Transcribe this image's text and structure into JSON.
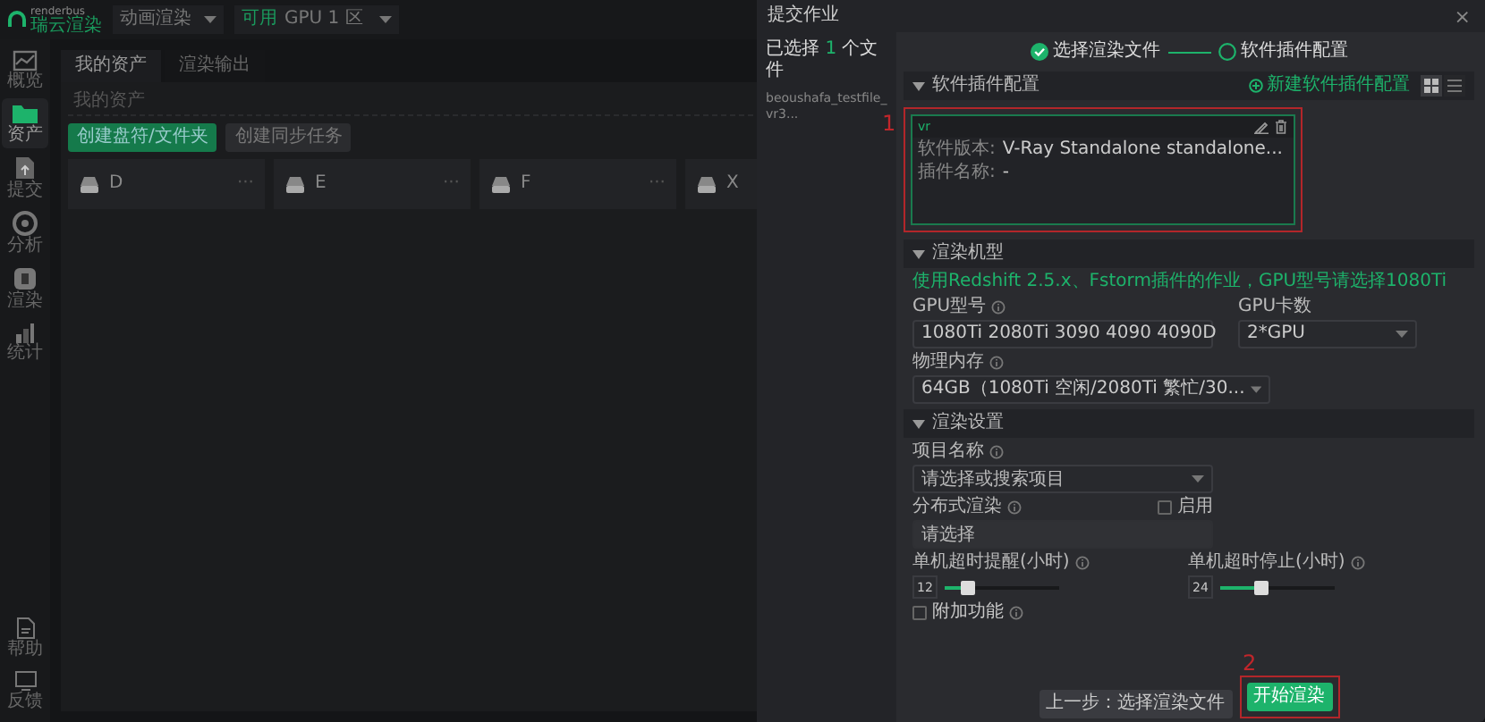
{
  "app": {
    "logo": {
      "brand": "renderbus",
      "name": "瑞云渲染"
    },
    "render_type": "动画渲染",
    "zone": {
      "badge": "可用",
      "name": "GPU 1 区"
    }
  },
  "sidebar": [
    {
      "label": "概览",
      "selected": false
    },
    {
      "label": "资产",
      "selected": true
    },
    {
      "label": "提交",
      "selected": false
    },
    {
      "label": "分析",
      "selected": false
    },
    {
      "label": "渲染",
      "selected": false
    },
    {
      "label": "统计",
      "selected": false
    },
    {
      "label": "帮助",
      "selected": false
    },
    {
      "label": "反馈",
      "selected": false
    }
  ],
  "tabs": [
    {
      "label": "我的资产",
      "selected": true
    },
    {
      "label": "渲染输出",
      "selected": false
    }
  ],
  "breadcrumb": "我的资产",
  "actions": [
    {
      "label": "创建盘符/文件夹",
      "kind": "primary"
    },
    {
      "label": "创建同步任务",
      "kind": "secondary"
    }
  ],
  "drives": [
    {
      "name": "D",
      "more": "···"
    },
    {
      "name": "E",
      "more": "···"
    },
    {
      "name": "F",
      "more": "···"
    },
    {
      "name": "X"
    }
  ],
  "dialog": {
    "title": "提交作业",
    "close": "×",
    "selected_count": {
      "prefix": "已选择",
      "count": "1",
      "suffix": "个文件"
    },
    "files": [
      "beoushafa_testfile_vr3..."
    ],
    "steps": [
      {
        "label": "选择渲染文件",
        "done": true
      },
      {
        "label": "软件插件配置",
        "done": false
      }
    ],
    "software_section": {
      "title": "软件插件配置",
      "expanded": true,
      "new_config": "新建软件插件配置",
      "views": [
        {
          "kind": "grid",
          "selected": true
        },
        {
          "kind": "list",
          "selected": false
        }
      ],
      "configs": [
        {
          "name": "vr",
          "version_label": "软件版本:",
          "version": "V-Ray Standalone standalone...",
          "plugin_label": "插件名称:",
          "plugin": "-",
          "callout": "1"
        }
      ]
    },
    "machine_section": {
      "title": "渲染机型",
      "expanded": true,
      "note": "使用Redshift 2.5.x、Fstorm插件的作业，GPU型号请选择1080Ti",
      "fields": [
        {
          "label": "GPU型号",
          "info": true,
          "kind": "select",
          "value": "1080Ti 2080Ti 3090 4090 4090D"
        },
        {
          "label": "GPU卡数",
          "info": false,
          "kind": "select",
          "value": "2*GPU"
        },
        {
          "label": "物理内存",
          "info": true,
          "kind": "select",
          "value": "64GB（1080Ti 空闲/2080Ti 繁忙/30..."
        }
      ]
    },
    "render_section": {
      "title": "渲染设置",
      "expanded": true,
      "project": {
        "label": "项目名称",
        "info": true,
        "kind": "select",
        "placeholder": "请选择或搜索项目"
      },
      "distributed": {
        "label": "分布式渲染",
        "info": true,
        "enable_label": "启用",
        "checked": false,
        "placeholder": "请选择"
      },
      "sliders": [
        {
          "label": "单机超时提醒(小时)",
          "value": "12",
          "level": 0.2
        },
        {
          "label": "单机超时停止(小时)",
          "value": "24",
          "level": 0.36
        }
      ],
      "extra": {
        "label": "附加功能",
        "checked": false
      }
    },
    "footer": [
      {
        "label": "上一步：选择渲染文件",
        "kind": "secondary"
      },
      {
        "label": "开始渲染",
        "kind": "primary",
        "callout": "2"
      }
    ]
  }
}
